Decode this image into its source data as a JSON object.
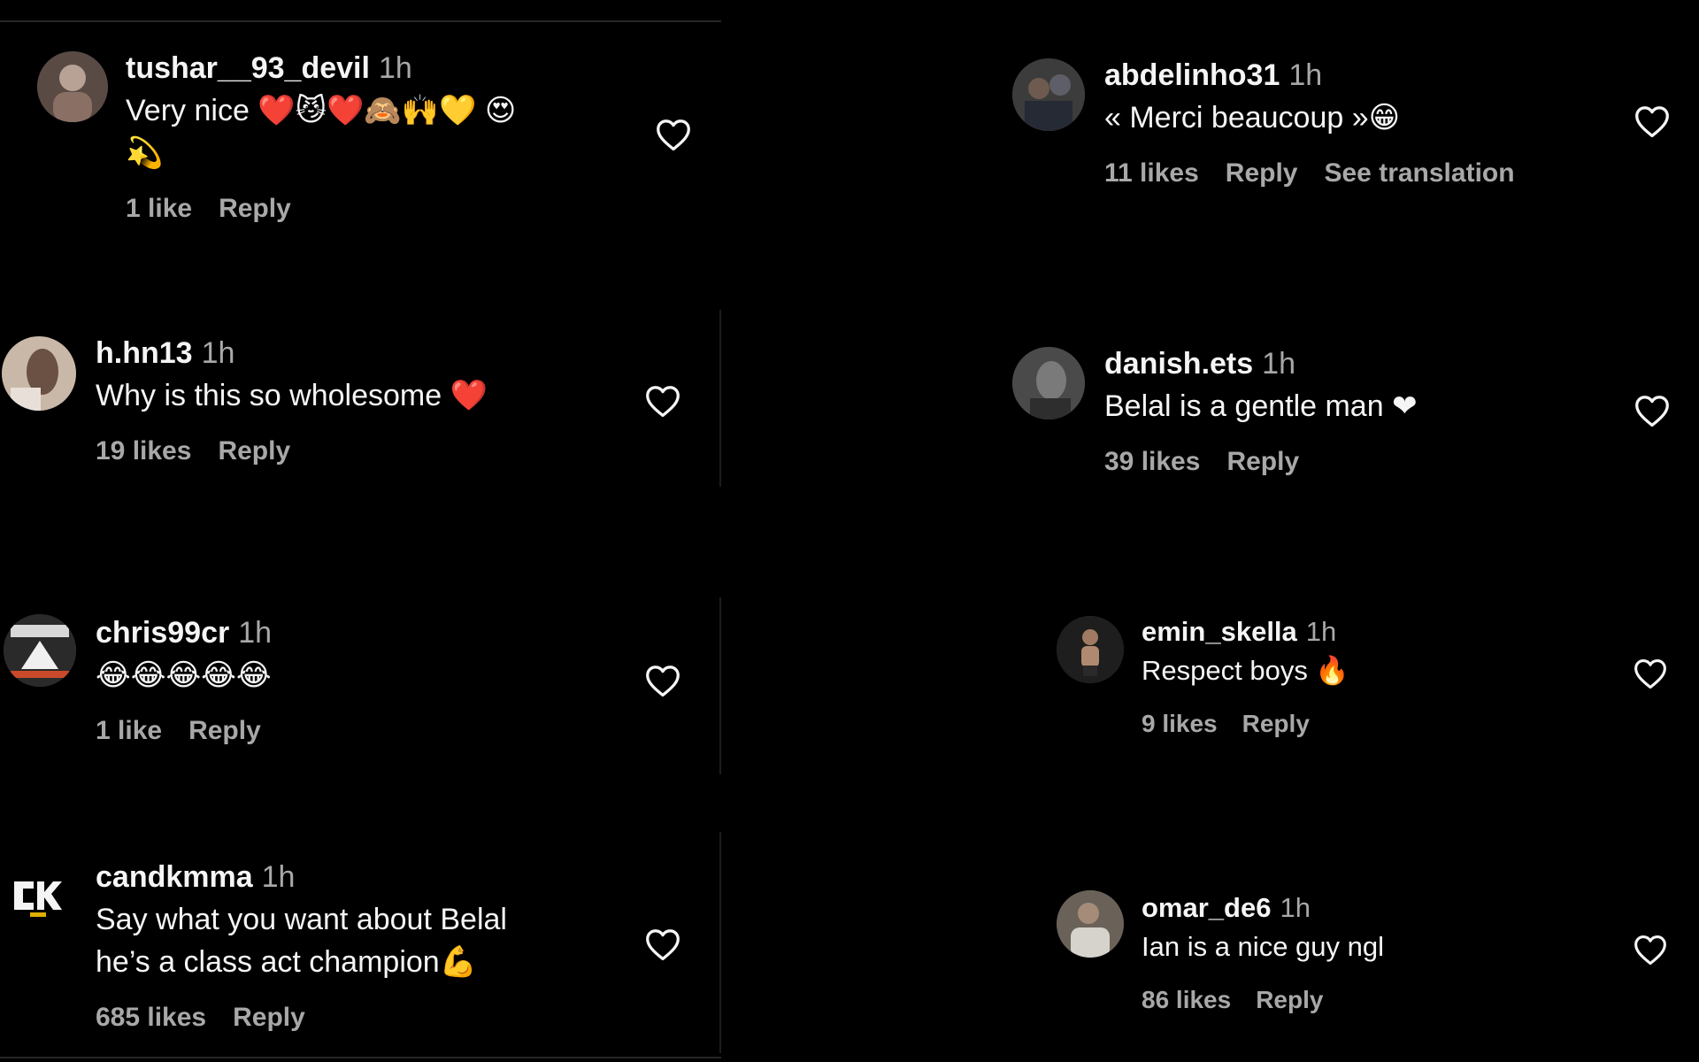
{
  "left_comments": [
    {
      "username": "tushar__93_devil",
      "time": "1h",
      "text": "Very nice ❤️😼❤️🙈🙌💛 😍",
      "text_line2": "💫",
      "likes": "1 like",
      "reply": "Reply"
    },
    {
      "username": "h.hn13",
      "time": "1h",
      "text": "Why is this so wholesome ❤️",
      "likes": "19 likes",
      "reply": "Reply"
    },
    {
      "username": "chris99cr",
      "time": "1h",
      "text": "😂😂😂😂😂",
      "likes": "1 like",
      "reply": "Reply"
    },
    {
      "username": "candkmma",
      "time": "1h",
      "text": "Say what you want about Belal",
      "text_line2": "he’s a class act champion💪",
      "likes": "685 likes",
      "reply": "Reply"
    }
  ],
  "right_comments": [
    {
      "username": "abdelinho31",
      "time": "1h",
      "text": "« Merci beaucoup »😁",
      "likes": "11 likes",
      "reply": "Reply",
      "see_translation": "See translation"
    },
    {
      "username": "danish.ets",
      "time": "1h",
      "text": "Belal is a gentle man ❤",
      "likes": "39 likes",
      "reply": "Reply"
    },
    {
      "username": "emin_skella",
      "time": "1h",
      "text": "Respect boys 🔥",
      "likes": "9 likes",
      "reply": "Reply"
    },
    {
      "username": "omar_de6",
      "time": "1h",
      "text": "Ian is a nice guy ngl",
      "likes": "86 likes",
      "reply": "Reply"
    }
  ],
  "icons": {
    "heart": "heart-outline-icon",
    "avatar": "user-avatar"
  },
  "colors": {
    "background": "#000000",
    "primary_text": "#f5f5f5",
    "secondary_text": "#a8a8a8",
    "divider": "#262626"
  }
}
